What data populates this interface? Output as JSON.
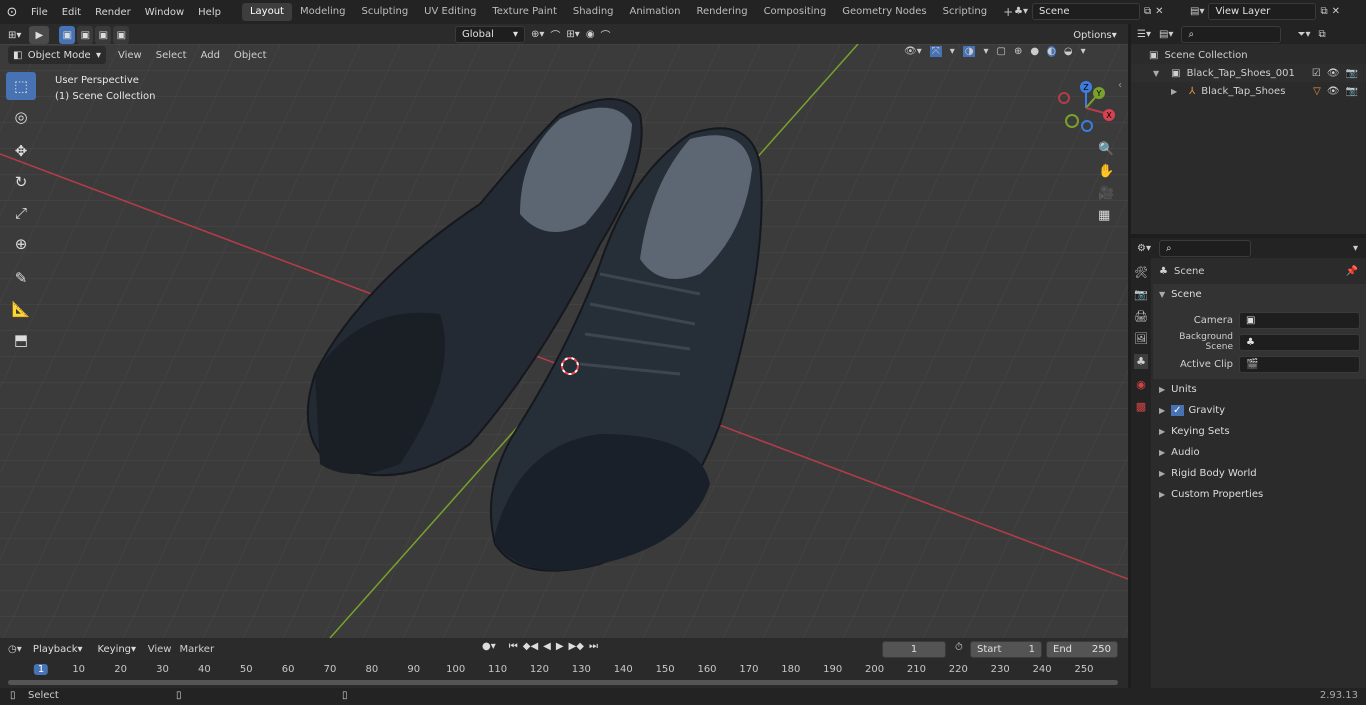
{
  "menu": [
    "File",
    "Edit",
    "Render",
    "Window",
    "Help"
  ],
  "workspaces": [
    "Layout",
    "Modeling",
    "Sculpting",
    "UV Editing",
    "Texture Paint",
    "Shading",
    "Animation",
    "Rendering",
    "Compositing",
    "Geometry Nodes",
    "Scripting"
  ],
  "active_workspace": "Layout",
  "scene_field": "Scene",
  "view_layer_field": "View Layer",
  "header": {
    "mode": "Object Mode",
    "view": "View",
    "select": "Select",
    "add": "Add",
    "object": "Object",
    "transform": "Global",
    "options": "Options"
  },
  "overlay_text": {
    "line1": "User Perspective",
    "line2": "(1) Scene Collection"
  },
  "gizmo": {
    "x": "X",
    "y": "Y",
    "z": "Z"
  },
  "outliner": {
    "root": "Scene Collection",
    "collection": "Black_Tap_Shoes_001",
    "object": "Black_Tap_Shoes"
  },
  "properties": {
    "context": "Scene",
    "panel": "Scene",
    "camera_label": "Camera",
    "bg_scene_label": "Background Scene",
    "active_clip_label": "Active Clip",
    "subpanels": [
      "Units",
      "Gravity",
      "Keying Sets",
      "Audio",
      "Rigid Body World",
      "Custom Properties"
    ]
  },
  "timeline": {
    "playback": "Playback",
    "keying": "Keying",
    "view": "View",
    "marker": "Marker",
    "current_frame": "1",
    "start_label": "Start",
    "start": "1",
    "end_label": "End",
    "end": "250",
    "ticks": [
      "1",
      "10",
      "20",
      "30",
      "40",
      "50",
      "60",
      "70",
      "80",
      "90",
      "100",
      "110",
      "120",
      "130",
      "140",
      "150",
      "160",
      "170",
      "180",
      "190",
      "200",
      "210",
      "220",
      "230",
      "240",
      "250"
    ]
  },
  "status": {
    "left": "Select",
    "version": "2.93.13"
  },
  "colors": {
    "accent": "#4772b3",
    "x_axis": "#b53c4a",
    "y_axis": "#7aa12c",
    "z_axis": "#3d7de0"
  }
}
